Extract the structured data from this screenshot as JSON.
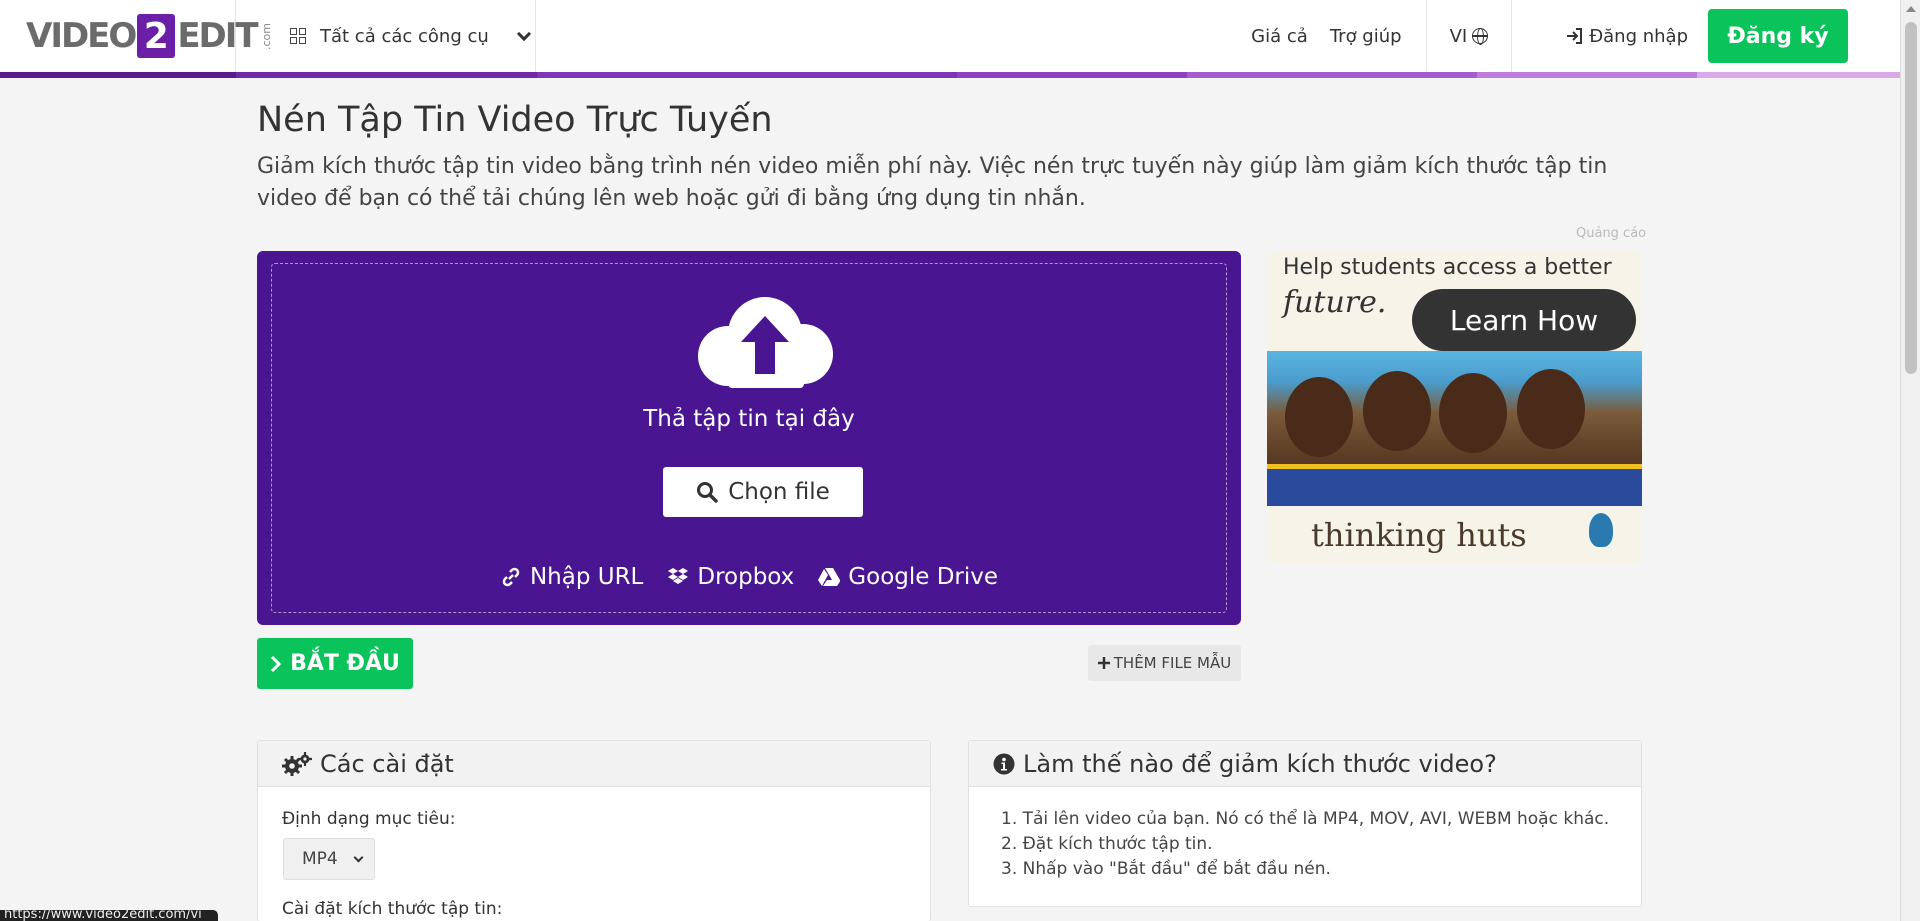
{
  "header": {
    "logo": {
      "left": "VIDEO",
      "digit": "2",
      "right": "EDIT",
      "suffix": ".com"
    },
    "tools_label": "Tất cả các công cụ",
    "nav": {
      "pricing": "Giá cả",
      "help": "Trợ giúp",
      "lang": "VI"
    },
    "login": "Đăng nhập",
    "signup": "Đăng ký"
  },
  "progress_colors": [
    "#5a1a8a",
    "#6e2aa6",
    "#7d36b6",
    "#8e44c2",
    "#a25ecd",
    "#bd7ed9",
    "#d9a8e6"
  ],
  "main": {
    "title": "Nén Tập Tin Video Trực Tuyến",
    "description": "Giảm kích thước tập tin video bằng trình nén video miễn phí này. Việc nén trực tuyến này giúp làm giảm kích thước tập tin video để bạn có thể tải chúng lên web hoặc gửi đi bằng ứng dụng tin nhắn.",
    "ad_label": "Quảng cáo"
  },
  "dropzone": {
    "drop_text": "Thả tập tin tại đây",
    "choose_file": "Chọn file",
    "sources": {
      "url": "Nhập URL",
      "dropbox": "Dropbox",
      "gdrive": "Google Drive"
    },
    "bg_color": "#4a1590"
  },
  "actions": {
    "start": "BẮT ĐẦU",
    "add_sample": "THÊM FILE MẪU"
  },
  "ad": {
    "headline": "Help students access a better",
    "future": "future.",
    "cta": "Learn How",
    "brand": "thinking huts"
  },
  "settings": {
    "title": "Các cài đặt",
    "target_format_label": "Định dạng mục tiêu:",
    "target_format_value": "MP4",
    "size_label": "Cài đặt kích thước tập tin:"
  },
  "howto": {
    "title": "Làm thế nào để giảm kích thước video?",
    "steps": [
      "1. Tải lên video của bạn. Nó có thể là MP4, MOV, AVI, WEBM hoặc khác.",
      "2. Đặt kích thước tập tin.",
      "3. Nhấp vào \"Bắt đầu\" để bắt đầu nén."
    ]
  },
  "status_url": "https://www.video2edit.com/vi"
}
